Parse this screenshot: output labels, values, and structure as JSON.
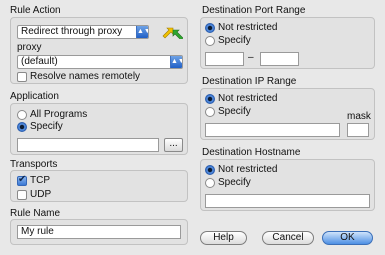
{
  "rule_action": {
    "title": "Rule Action",
    "action_value": "Redirect through proxy",
    "proxy_label": "proxy",
    "proxy_value": "(default)",
    "resolve_label": "Resolve names remotely",
    "resolve_checked": false
  },
  "application": {
    "title": "Application",
    "options": [
      "All Programs",
      "Specify"
    ],
    "selected": "Specify",
    "path_value": "",
    "browse_label": "..."
  },
  "transports": {
    "title": "Transports",
    "tcp_label": "TCP",
    "tcp_checked": true,
    "udp_label": "UDP",
    "udp_checked": false
  },
  "rule_name": {
    "title": "Rule Name",
    "value": "My rule"
  },
  "dest_port": {
    "title": "Destination Port Range",
    "options": [
      "Not restricted",
      "Specify"
    ],
    "selected": "Not restricted",
    "from_value": "",
    "separator": "–",
    "to_value": ""
  },
  "dest_ip": {
    "title": "Destination IP Range",
    "options": [
      "Not restricted",
      "Specify"
    ],
    "selected": "Not restricted",
    "ip_value": "",
    "mask_label": "mask",
    "mask_value": ""
  },
  "dest_host": {
    "title": "Destination Hostname",
    "options": [
      "Not restricted",
      "Specify"
    ],
    "selected": "Not restricted",
    "host_value": ""
  },
  "buttons": {
    "help": "Help",
    "cancel": "Cancel",
    "ok": "OK"
  },
  "colors": {
    "accent": "#3a78d4",
    "arrow_yellow": "#f2c200",
    "arrow_green": "#2fa62f"
  },
  "icons": {
    "select_arrow": "select-chevron-icon",
    "proxy_direction": "proxy-direction-arrows-icon"
  }
}
